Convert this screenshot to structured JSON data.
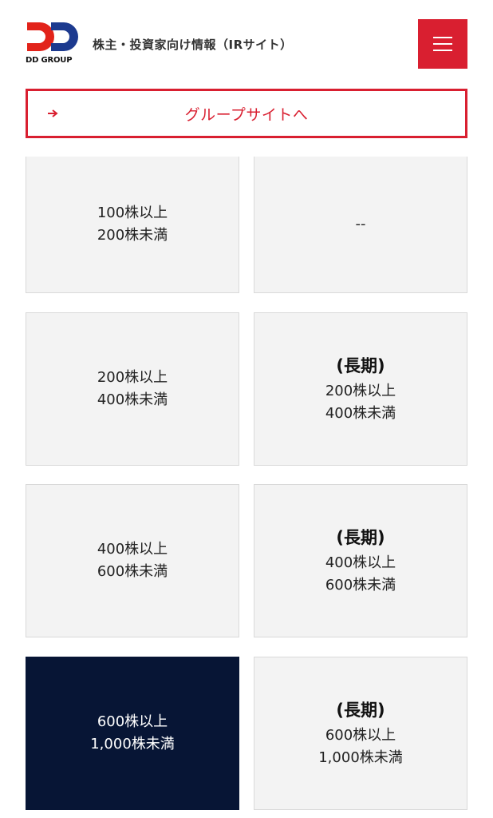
{
  "header": {
    "logo_text": "DD GROUP",
    "site_title": "株主・投資家向け情報（IRサイト）",
    "menu_icon": "hamburger-icon",
    "brand_color": "#d91f30"
  },
  "group_link": {
    "label": "グループサイトへ",
    "arrow_icon": "arrow-right-icon"
  },
  "table": {
    "highlight_color": "#071535",
    "rows": [
      {
        "left": [
          "100株以上",
          "200株未満"
        ],
        "right": {
          "term": "",
          "lines": [
            "--"
          ]
        }
      },
      {
        "left": [
          "200株以上",
          "400株未満"
        ],
        "right": {
          "term": "(長期)",
          "lines": [
            "200株以上",
            "400株未満"
          ]
        }
      },
      {
        "left": [
          "400株以上",
          "600株未満"
        ],
        "right": {
          "term": "(長期)",
          "lines": [
            "400株以上",
            "600株未満"
          ]
        }
      },
      {
        "left": [
          "600株以上",
          "1,000株未満"
        ],
        "right": {
          "term": "(長期)",
          "lines": [
            "600株以上",
            "1,000株未満"
          ]
        }
      }
    ]
  }
}
